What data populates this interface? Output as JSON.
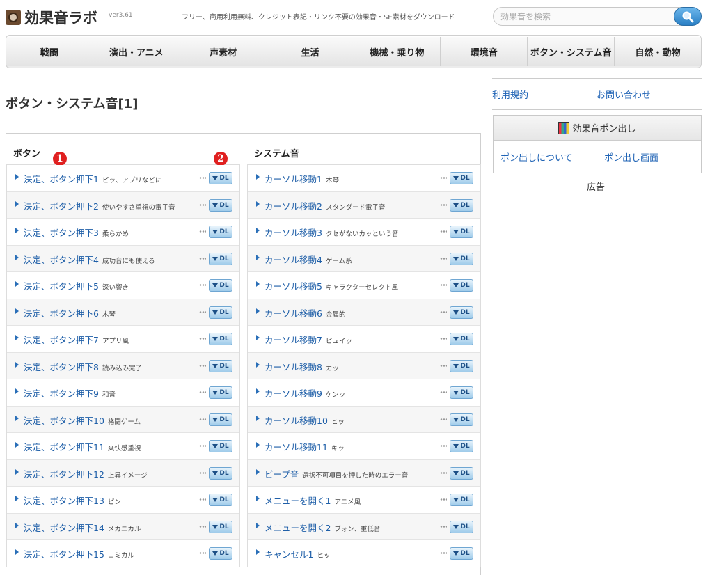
{
  "header": {
    "logo": "効果音ラボ",
    "version": "ver3.61",
    "tagline": "フリー、商用利用無料、クレジット表記・リンク不要の効果音・SE素材をダウンロード",
    "search_placeholder": "効果音を検索"
  },
  "nav": [
    "戦闘",
    "演出・アニメ",
    "声素材",
    "生活",
    "機械・乗り物",
    "環境音",
    "ボタン・システム音",
    "自然・動物"
  ],
  "page_title": "ボタン・システム音[1]",
  "sidebar": {
    "links": [
      "利用規約",
      "お問い合わせ"
    ],
    "box_title": "効果音ポン出し",
    "box_links": [
      "ポン出しについて",
      "ポン出し画面"
    ],
    "ad_label": "広告"
  },
  "annotations": [
    "1",
    "2"
  ],
  "dl_label": "DL",
  "columns": [
    {
      "heading": "ボタン",
      "rows": [
        {
          "title": "決定、ボタン押下1",
          "desc": "ピッ、アプリなどに"
        },
        {
          "title": "決定、ボタン押下2",
          "desc": "使いやすさ重視の電子音"
        },
        {
          "title": "決定、ボタン押下3",
          "desc": "柔らかめ"
        },
        {
          "title": "決定、ボタン押下4",
          "desc": "成功音にも使える"
        },
        {
          "title": "決定、ボタン押下5",
          "desc": "深い響き"
        },
        {
          "title": "決定、ボタン押下6",
          "desc": "木琴"
        },
        {
          "title": "決定、ボタン押下7",
          "desc": "アプリ風"
        },
        {
          "title": "決定、ボタン押下8",
          "desc": "読み込み完了"
        },
        {
          "title": "決定、ボタン押下9",
          "desc": "和音"
        },
        {
          "title": "決定、ボタン押下10",
          "desc": "格闘ゲーム"
        },
        {
          "title": "決定、ボタン押下11",
          "desc": "爽快感重視"
        },
        {
          "title": "決定、ボタン押下12",
          "desc": "上昇イメージ"
        },
        {
          "title": "決定、ボタン押下13",
          "desc": "ピン"
        },
        {
          "title": "決定、ボタン押下14",
          "desc": "メカニカル"
        },
        {
          "title": "決定、ボタン押下15",
          "desc": "コミカル"
        }
      ]
    },
    {
      "heading": "システム音",
      "rows": [
        {
          "title": "カーソル移動1",
          "desc": "木琴"
        },
        {
          "title": "カーソル移動2",
          "desc": "スタンダード電子音"
        },
        {
          "title": "カーソル移動3",
          "desc": "クセがないカッという音"
        },
        {
          "title": "カーソル移動4",
          "desc": "ゲーム系"
        },
        {
          "title": "カーソル移動5",
          "desc": "キャラクターセレクト風"
        },
        {
          "title": "カーソル移動6",
          "desc": "金属的"
        },
        {
          "title": "カーソル移動7",
          "desc": "ピュイッ"
        },
        {
          "title": "カーソル移動8",
          "desc": "カッ"
        },
        {
          "title": "カーソル移動9",
          "desc": "ケンッ"
        },
        {
          "title": "カーソル移動10",
          "desc": "ヒッ"
        },
        {
          "title": "カーソル移動11",
          "desc": "キッ"
        },
        {
          "title": "ビープ音",
          "desc": "選択不可項目を押した時のエラー音"
        },
        {
          "title": "メニューを開く1",
          "desc": "アニメ風"
        },
        {
          "title": "メニューを開く2",
          "desc": "ブォン、重低音"
        },
        {
          "title": "キャンセル1",
          "desc": "ヒッ"
        }
      ]
    }
  ]
}
